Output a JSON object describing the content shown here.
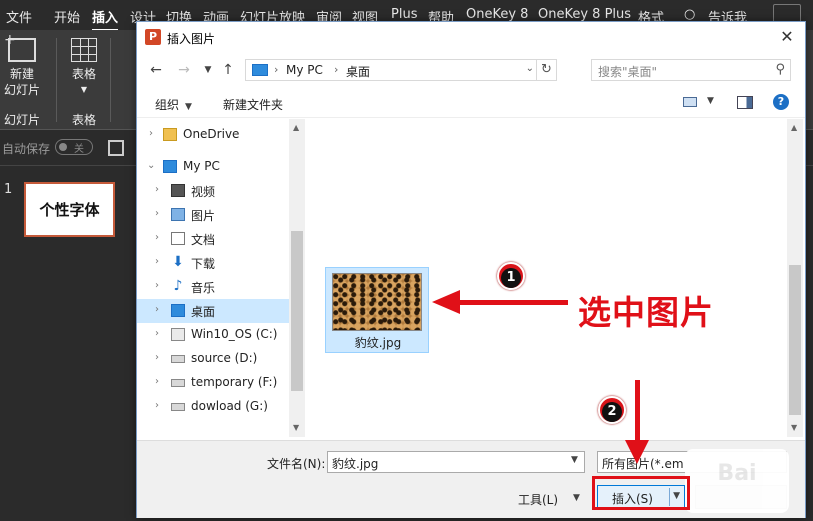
{
  "ppt": {
    "tabs": [
      "文件",
      "开始",
      "插入",
      "设计",
      "切换",
      "动画",
      "幻灯片放映",
      "审阅",
      "视图",
      "Plus",
      "帮助",
      "OneKey 8",
      "OneKey 8 Plus",
      "格式",
      "告诉我"
    ],
    "active_tab": "插入",
    "ribbon": {
      "new_slide_line1": "新建",
      "new_slide_line2": "幻灯片",
      "table_label": "表格",
      "group_slides": "幻灯片",
      "group_table": "表格"
    },
    "autosave_label": "自动保存",
    "autosave_state": "关",
    "slide_number": "1",
    "slide_text": "个性字体"
  },
  "dialog": {
    "title": "插入图片",
    "address": {
      "parts": [
        "My PC",
        "桌面"
      ],
      "search_placeholder": "搜索\"桌面\""
    },
    "toolbar": {
      "organize": "组织",
      "new_folder": "新建文件夹"
    },
    "nav_items": [
      {
        "label": "OneDrive",
        "icon": "folder-icon",
        "level": 0
      },
      {
        "label": "My PC",
        "icon": "computer-icon",
        "level": 0
      },
      {
        "label": "视频",
        "icon": "video-folder-icon",
        "level": 1
      },
      {
        "label": "图片",
        "icon": "pictures-folder-icon",
        "level": 1
      },
      {
        "label": "文档",
        "icon": "documents-folder-icon",
        "level": 1
      },
      {
        "label": "下载",
        "icon": "downloads-folder-icon",
        "level": 1
      },
      {
        "label": "音乐",
        "icon": "music-folder-icon",
        "level": 1
      },
      {
        "label": "桌面",
        "icon": "desktop-folder-icon",
        "level": 1,
        "selected": true
      },
      {
        "label": "Win10_OS (C:)",
        "icon": "windows-drive-icon",
        "level": 1
      },
      {
        "label": "source (D:)",
        "icon": "drive-icon",
        "level": 1
      },
      {
        "label": "temporary (F:)",
        "icon": "drive-icon",
        "level": 1
      },
      {
        "label": "dowload (G:)",
        "icon": "drive-icon",
        "level": 1
      }
    ],
    "file": {
      "name": "豹纹.jpg"
    },
    "bottom": {
      "filename_label": "文件名(N):",
      "filename_value": "豹纹.jpg",
      "filetype_value": "所有图片(*.em",
      "tools_label": "工具(L)",
      "insert_label": "插入(S)"
    }
  },
  "annotations": {
    "step1": "1",
    "step2": "2",
    "callout": "选中图片",
    "color": "#e01018"
  },
  "watermark": "Bai"
}
